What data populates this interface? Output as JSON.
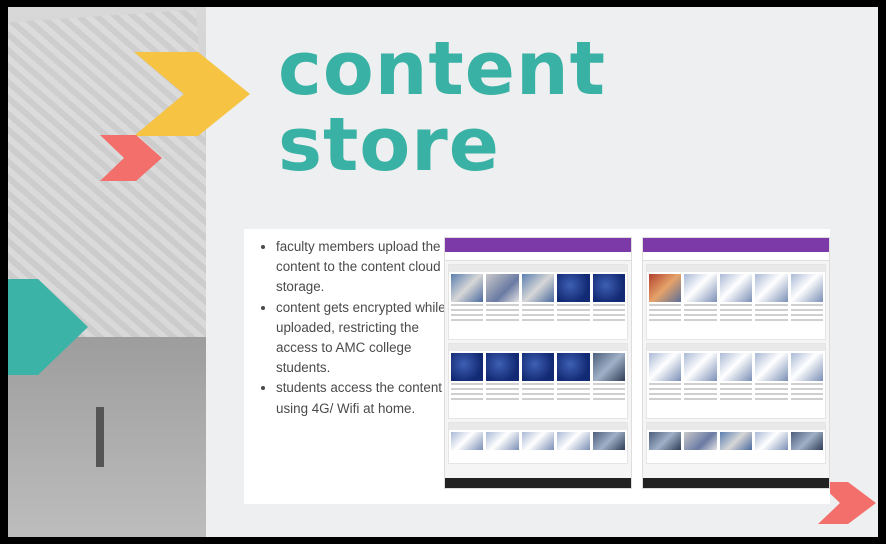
{
  "slide": {
    "title_line1": "content",
    "title_line2": "store"
  },
  "bullets": [
    "faculty members upload the content to the content cloud storage.",
    "content gets encrypted while uploaded, restricting the access to AMC college students.",
    "students access the content using 4G/ Wifi at home."
  ],
  "colors": {
    "title": "#39b1a4",
    "chevron_yellow": "#f6c342",
    "chevron_red": "#f26f6b",
    "chevron_teal": "#3bb3a6",
    "app_bar": "#7c3aa8"
  },
  "icons": {
    "chevrons": "chevron-right-icon"
  }
}
